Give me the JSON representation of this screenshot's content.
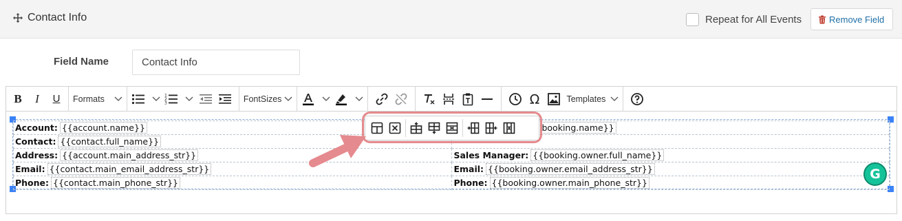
{
  "header": {
    "title": "Contact Info",
    "repeat_label": "Repeat for All Events",
    "remove_label": "Remove Field"
  },
  "field": {
    "label": "Field Name",
    "value": "Contact Info"
  },
  "toolbar": {
    "formats": "Formats",
    "fontsizes": "FontSizes",
    "templates": "Templates"
  },
  "table": {
    "rows": [
      {
        "k1": "Account:",
        "v1": "{{account.name}}",
        "k2": "",
        "v2": "booking.name}}"
      },
      {
        "k1": "Contact:",
        "v1": "{{contact.full_name}}",
        "k2": "",
        "v2": ""
      },
      {
        "k1": "Address:",
        "v1": "{{account.main_address_str}}",
        "k2": "Sales Manager:",
        "v2": "{{booking.owner.full_name}}"
      },
      {
        "k1": "Email:",
        "v1": "{{contact.main_email_address_str}}",
        "k2": "Email:",
        "v2": "{{booking.owner.email_address_str}}"
      },
      {
        "k1": "Phone:",
        "v1": "{{contact.main_phone_str}}",
        "k2": "Phone:",
        "v2": "{{booking.owner.main_phone_str}}"
      }
    ]
  },
  "colors": {
    "accent_blue": "#3b82f6",
    "remove_red": "#c0392b",
    "highlight_pink": "#e58a8e",
    "grammarly_green": "#15c39a"
  },
  "grammarly": {
    "letter": "G"
  }
}
